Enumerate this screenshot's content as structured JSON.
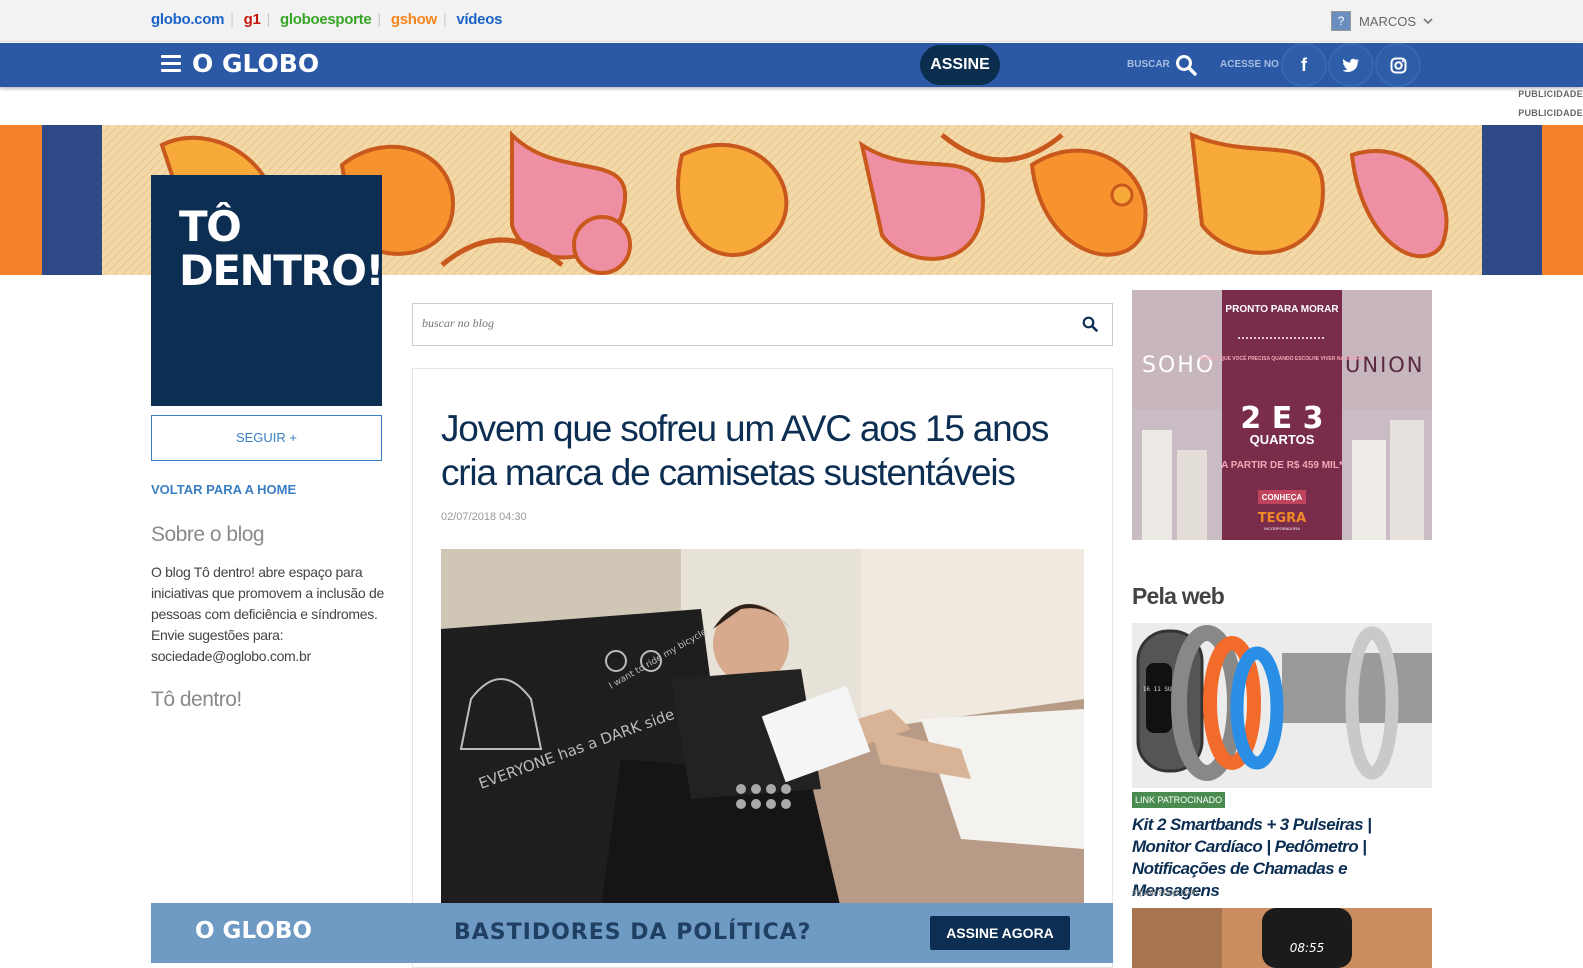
{
  "globalbar": {
    "links": [
      {
        "label": "globo.com",
        "color": "#1a63c6"
      },
      {
        "label": "g1",
        "color": "#c4170c"
      },
      {
        "label": "globoesporte",
        "color": "#39a527"
      },
      {
        "label": "gshow",
        "color": "#f6851f"
      },
      {
        "label": "vídeos",
        "color": "#1a63c6"
      }
    ],
    "user": {
      "name": "MARCOS",
      "avatar_icon": "user-avatar-icon"
    }
  },
  "header": {
    "logo": "O GLOBO",
    "assine": "ASSINE",
    "buscar": "BUSCAR",
    "acesse": "ACESSE NO",
    "social": [
      "facebook-icon",
      "twitter-icon",
      "instagram-icon"
    ],
    "brand_color": "#2b59a6"
  },
  "publicidade": [
    "PUBLICIDADE",
    "PUBLICIDADE"
  ],
  "blog": {
    "title_line1": "TÔ",
    "title_line2": "DENTRO!",
    "follow": "SEGUIR +",
    "back_home": "VOLTAR PARA A HOME",
    "about_title": "Sobre o blog",
    "about_text": "O blog Tô dentro! abre espaço para iniciativas que promovem a inclusão de pessoas com deficiência e síndromes. Envie sugestões para: sociedade@oglobo.com.br",
    "section_link": "Tô dentro!"
  },
  "search": {
    "placeholder": "buscar no blog"
  },
  "article": {
    "title": "Jovem que sofreu um AVC aos 15 anos cria marca de camisetas sustentáveis",
    "date": "02/07/2018 04:30"
  },
  "ad": {
    "left": "SOHO",
    "right": "UNION",
    "headline": "PRONTO PARA MORAR",
    "sub": "TUDO O QUE VOCÊ PRECISA QUANDO ESCOLHE VIVER NA BARRA.",
    "rooms": "2 E 3",
    "rooms_label": "QUARTOS",
    "price": "A PARTIR DE R$ 459 MIL*",
    "cta": "CONHEÇA",
    "brand": "TEGRA",
    "brand_sub": "INCORPORADORA"
  },
  "pela_web": {
    "title": "Pela web",
    "badge": "LINK PATROCINADO",
    "item_title": "Kit 2 Smartbands + 3 Pulseiras | Monitor Cardíaco | Pedômetro | Notificações de Chamadas e Mensagens",
    "item_source": "squaloshop.com",
    "watch1_time": "16 11 SUN",
    "watch2_time": "08:55"
  },
  "promo": {
    "logo": "O GLOBO",
    "text": "BASTIDORES DA POLÍTICA?",
    "button": "ASSINE AGORA"
  },
  "shirts": {
    "print1": "EVERYONE has a DARK side",
    "print2": "I want to ride my bicycle"
  }
}
